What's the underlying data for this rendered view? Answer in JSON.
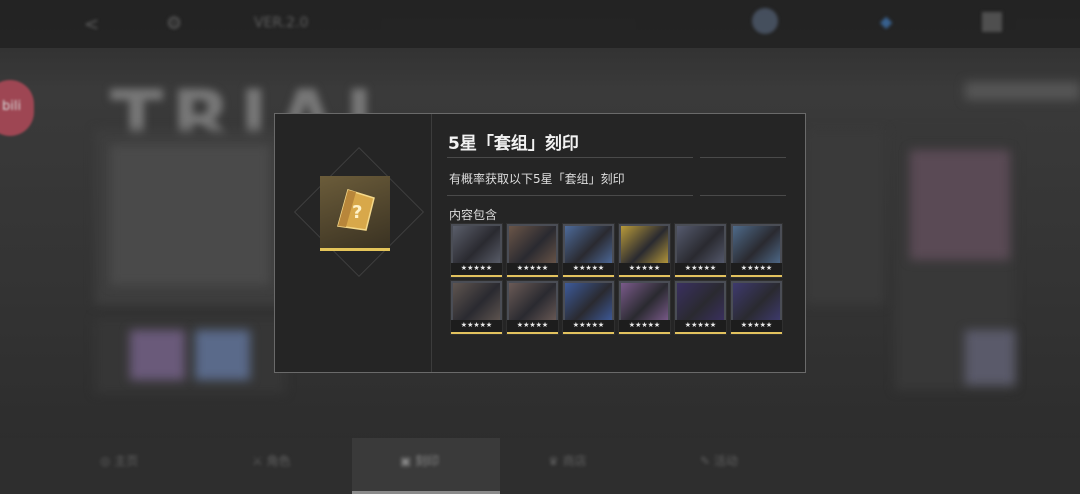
{
  "modal": {
    "title": "5星「套组」刻印",
    "description": "有概率获取以下5星「套组」刻印",
    "contents_label": "内容包含",
    "icon_glyph": "?",
    "cards": [
      {
        "name": "card-1",
        "color": "#5a5e6a",
        "stars": "★★★★★"
      },
      {
        "name": "card-2",
        "color": "#6a5548",
        "stars": "★★★★★"
      },
      {
        "name": "card-3",
        "color": "#4d6a9a",
        "stars": "★★★★★"
      },
      {
        "name": "card-4",
        "color": "#b89a3a",
        "stars": "★★★★★"
      },
      {
        "name": "card-5",
        "color": "#555a6e",
        "stars": "★★★★★"
      },
      {
        "name": "card-6",
        "color": "#4e6a8a",
        "stars": "★★★★★"
      },
      {
        "name": "card-7",
        "color": "#5f5550",
        "stars": "★★★★★"
      },
      {
        "name": "card-8",
        "color": "#6a5a56",
        "stars": "★★★★★"
      },
      {
        "name": "card-9",
        "color": "#3d5a9a",
        "stars": "★★★★★"
      },
      {
        "name": "card-10",
        "color": "#7a5a8a",
        "stars": "★★★★★"
      },
      {
        "name": "card-11",
        "color": "#3a3060",
        "stars": "★★★★★"
      },
      {
        "name": "card-12",
        "color": "#3e3a6e",
        "stars": "★★★★★"
      }
    ]
  },
  "background": {
    "banner_text": "TRIAL",
    "top_label": "VER.2.0",
    "side_badge": "bili",
    "bottom_tabs": [
      "主页",
      "角色",
      "刻印",
      "商店",
      "活动"
    ]
  }
}
